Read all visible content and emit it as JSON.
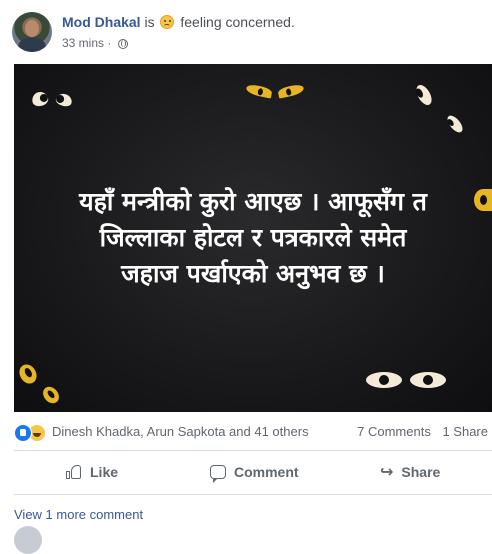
{
  "post": {
    "author": "Mod Dhakal",
    "feeling_prefix": "is",
    "feeling_text": "feeling concerned.",
    "time": "33 mins",
    "meta_sep": "·",
    "image_text_lines": [
      "यहाँ मन्त्रीको कुरो आएछ । आफूसँग त",
      "जिल्लाका होटल र पत्रकारले समेत",
      "जहाज पर्खाएको अनुभव छ ।"
    ]
  },
  "reactions": {
    "names": "Dinesh Khadka, Arun Sapkota and 41 others",
    "comments": "7 Comments",
    "shares": "1 Share"
  },
  "actions": {
    "like": "Like",
    "comment": "Comment",
    "share": "Share"
  },
  "comments": {
    "view_more": "View 1 more comment"
  },
  "icons": {
    "feeling": "worried-face-icon",
    "privacy": "globe-icon",
    "like_reaction": "like-reaction-icon",
    "haha_reaction": "haha-reaction-icon"
  },
  "colors": {
    "link": "#385898",
    "image_bg": "#1a1a1c",
    "like_blue": "#1877f2"
  }
}
